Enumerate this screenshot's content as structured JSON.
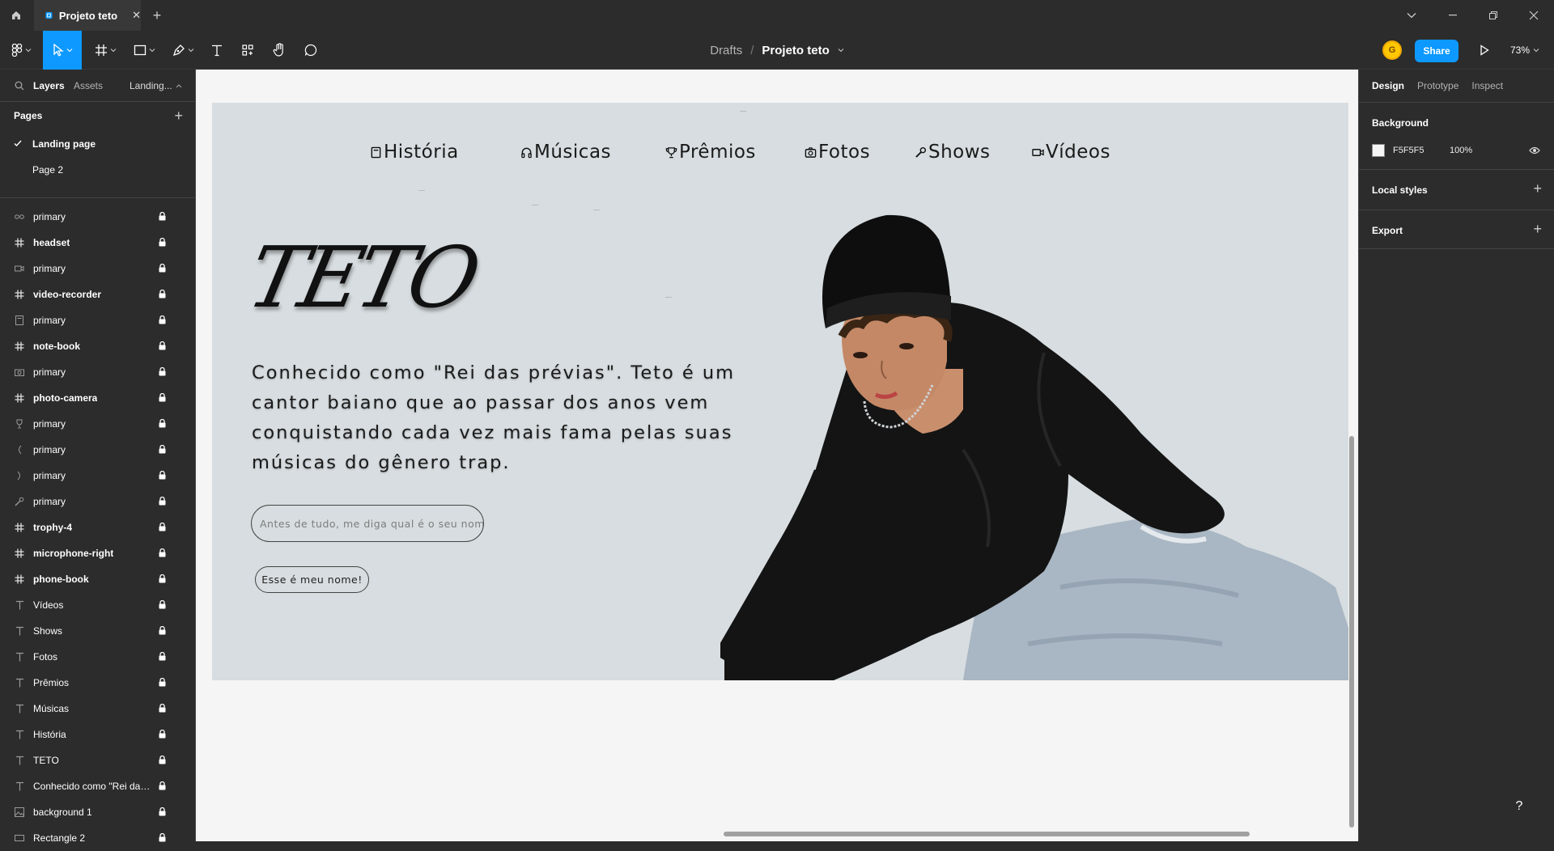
{
  "titlebar": {
    "tab_title": "Projeto teto",
    "tab_close": "✕",
    "new_tab": "+"
  },
  "toolbar": {
    "breadcrumb_parent": "Drafts",
    "breadcrumb_sep": "/",
    "file_name": "Projeto teto",
    "avatar_initial": "G",
    "share_label": "Share",
    "zoom": "73%"
  },
  "left_panel": {
    "tabs": [
      "Layers",
      "Assets",
      "Landing..."
    ],
    "pages_header": "Pages",
    "add_page": "+",
    "pages": [
      "Landing page",
      "Page 2"
    ],
    "layers": [
      {
        "name": "primary",
        "type": "component",
        "icon": "link-icon"
      },
      {
        "name": "headset",
        "type": "frame",
        "icon": "frame-icon"
      },
      {
        "name": "primary",
        "type": "component",
        "icon": "video-icon"
      },
      {
        "name": "video-recorder",
        "type": "frame",
        "icon": "frame-icon"
      },
      {
        "name": "primary",
        "type": "component",
        "icon": "notebook-icon"
      },
      {
        "name": "note-book",
        "type": "frame",
        "icon": "frame-icon"
      },
      {
        "name": "primary",
        "type": "component",
        "icon": "camera-icon"
      },
      {
        "name": "photo-camera",
        "type": "frame",
        "icon": "frame-icon"
      },
      {
        "name": "primary",
        "type": "component",
        "icon": "trophy-icon"
      },
      {
        "name": "primary",
        "type": "component",
        "icon": "bracket-left-icon"
      },
      {
        "name": "primary",
        "type": "component",
        "icon": "bracket-right-icon"
      },
      {
        "name": "primary",
        "type": "component",
        "icon": "microphone-icon"
      },
      {
        "name": "trophy-4",
        "type": "frame",
        "icon": "frame-icon"
      },
      {
        "name": "microphone-right",
        "type": "frame",
        "icon": "frame-icon"
      },
      {
        "name": "phone-book",
        "type": "frame",
        "icon": "frame-icon"
      },
      {
        "name": "Vídeos",
        "type": "text",
        "icon": "text-icon"
      },
      {
        "name": "Shows",
        "type": "text",
        "icon": "text-icon"
      },
      {
        "name": "Fotos",
        "type": "text",
        "icon": "text-icon"
      },
      {
        "name": "Prêmios",
        "type": "text",
        "icon": "text-icon"
      },
      {
        "name": "Músicas",
        "type": "text",
        "icon": "text-icon"
      },
      {
        "name": "História",
        "type": "text",
        "icon": "text-icon"
      },
      {
        "name": "TETO",
        "type": "text",
        "icon": "text-icon"
      },
      {
        "name": "Conhecido como \"Rei das...",
        "type": "text",
        "icon": "text-icon"
      },
      {
        "name": "background 1",
        "type": "image",
        "icon": "image-icon"
      },
      {
        "name": "Rectangle 2",
        "type": "rectangle",
        "icon": "rectangle-icon"
      }
    ]
  },
  "right_panel": {
    "tabs": [
      "Design",
      "Prototype",
      "Inspect"
    ],
    "background_title": "Background",
    "background_hex": "F5F5F5",
    "background_opacity": "100%",
    "local_styles": "Local styles",
    "export": "Export"
  },
  "canvas": {
    "nav": [
      "História",
      "Músicas",
      "Prêmios",
      "Fotos",
      "Shows",
      "Vídeos"
    ],
    "logo": "TETO",
    "bio": "Conhecido como \"Rei das prévias\". Teto é um cantor baiano que ao passar dos anos vem conquistando cada vez mais fama pelas suas músicas do gênero trap.",
    "name_placeholder": "Antes de tudo, me diga qual é o seu nome",
    "name_button": "Esse é meu nome!"
  },
  "help_label": "?",
  "colors": {
    "accent": "#0d99ff",
    "ui_bg": "#2c2c2c",
    "canvas_bg": "#f5f5f5",
    "frame_bg": "#d7dde0",
    "avatar": "#ffc700"
  }
}
